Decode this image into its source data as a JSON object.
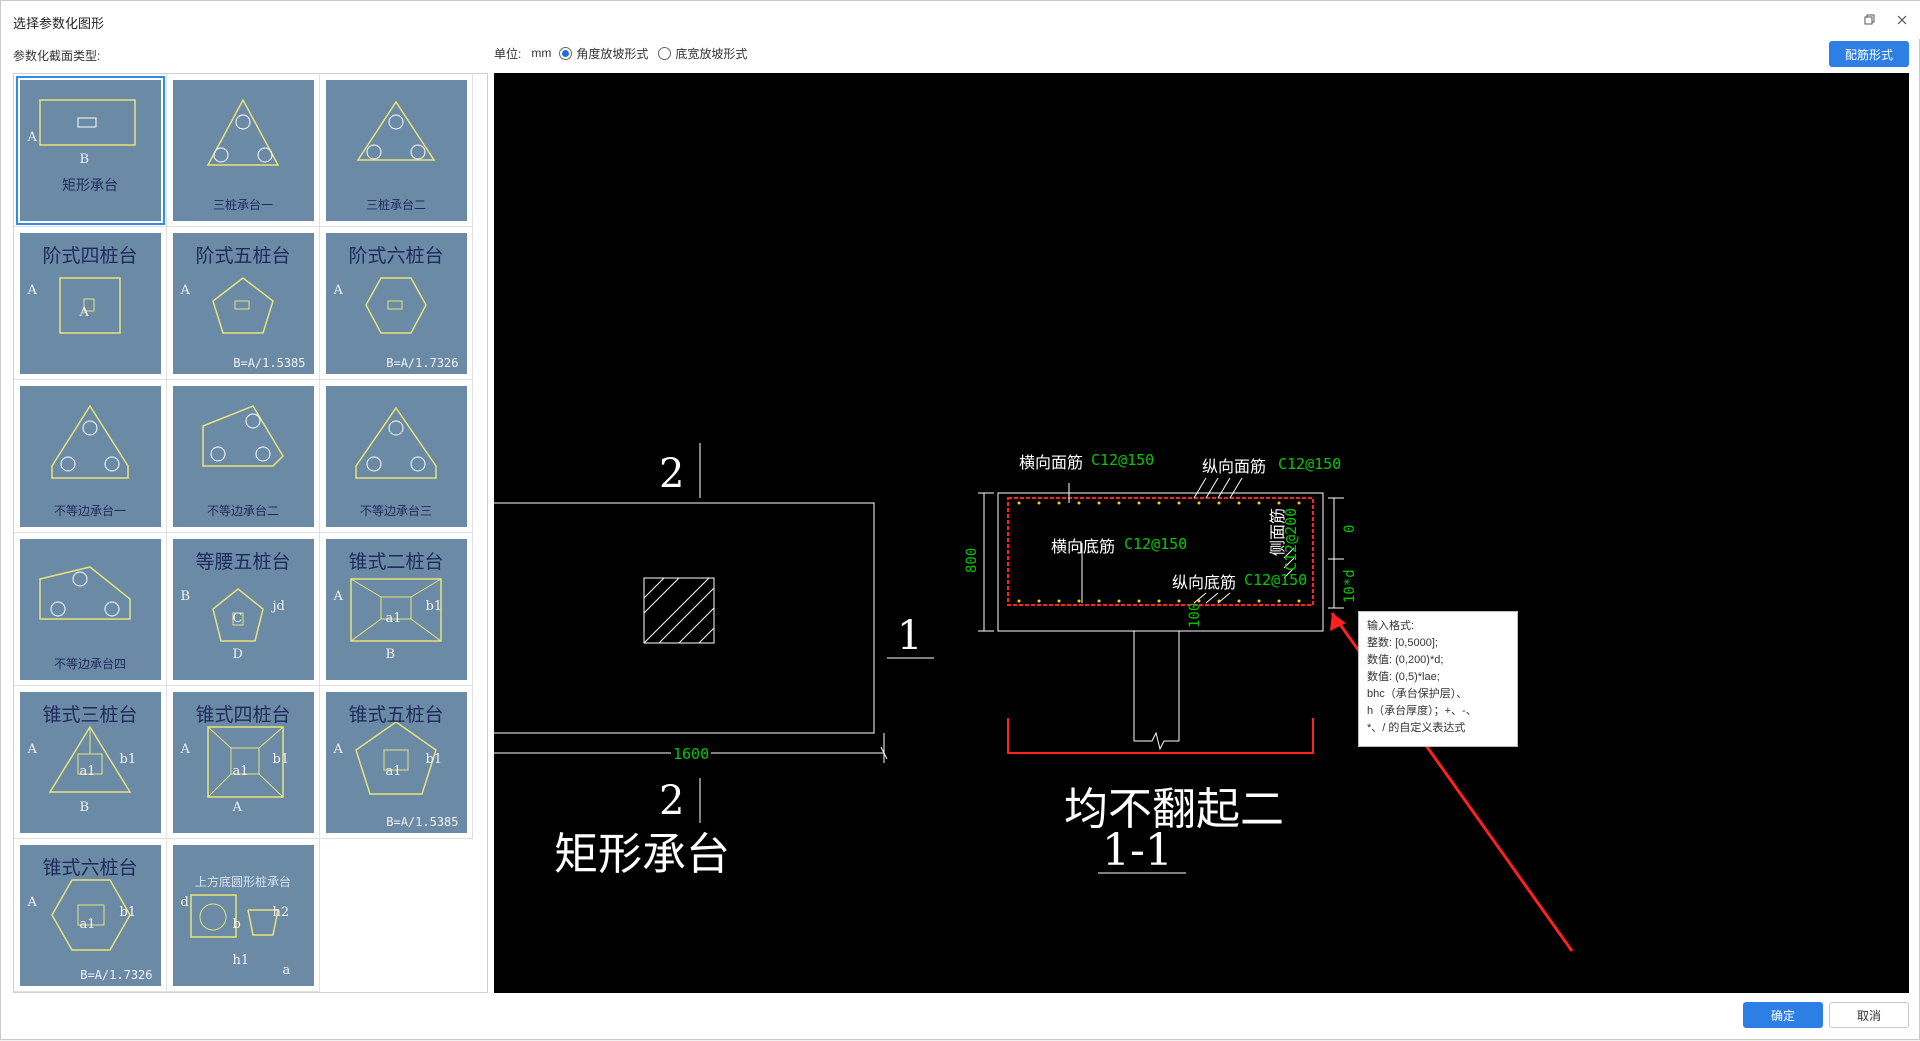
{
  "window": {
    "title": "选择参数化图形"
  },
  "header": {
    "section_label": "参数化截面类型:",
    "unit_label": "单位:",
    "unit_value": "mm",
    "options": [
      {
        "label": "角度放坡形式",
        "selected": true
      },
      {
        "label": "底宽放坡形式",
        "selected": false
      }
    ],
    "config_button": "配筋形式"
  },
  "shapes": [
    {
      "title": "",
      "bottom": "矩形承台",
      "note": "",
      "letters": [
        "A",
        "B"
      ],
      "selected": true
    },
    {
      "title": "",
      "bottom": "三桩承台一",
      "note": "",
      "letters": [],
      "selected": false
    },
    {
      "title": "",
      "bottom": "三桩承台二",
      "note": "",
      "letters": [],
      "selected": false
    },
    {
      "title": "阶式四桩台",
      "bottom": "",
      "note": "",
      "letters": [
        "A",
        "A"
      ],
      "selected": false
    },
    {
      "title": "阶式五桩台",
      "bottom": "",
      "note": "B=A/1.5385",
      "letters": [
        "A"
      ],
      "selected": false
    },
    {
      "title": "阶式六桩台",
      "bottom": "",
      "note": "B=A/1.7326",
      "letters": [
        "A"
      ],
      "selected": false
    },
    {
      "title": "",
      "bottom": "不等边承台一",
      "note": "",
      "letters": [],
      "selected": false
    },
    {
      "title": "",
      "bottom": "不等边承台二",
      "note": "",
      "letters": [],
      "selected": false
    },
    {
      "title": "",
      "bottom": "不等边承台三",
      "note": "",
      "letters": [],
      "selected": false
    },
    {
      "title": "",
      "bottom": "不等边承台四",
      "note": "",
      "letters": [],
      "selected": false
    },
    {
      "title": "等腰五桩台",
      "bottom": "",
      "note": "",
      "letters": [
        "B",
        "C",
        "jd",
        "D"
      ],
      "selected": false
    },
    {
      "title": "锥式二桩台",
      "bottom": "",
      "note": "",
      "letters": [
        "A",
        "a1",
        "b1",
        "B"
      ],
      "selected": false
    },
    {
      "title": "锥式三桩台",
      "bottom": "",
      "note": "",
      "letters": [
        "A",
        "a1",
        "b1",
        "B"
      ],
      "selected": false
    },
    {
      "title": "锥式四桩台",
      "bottom": "",
      "note": "",
      "letters": [
        "A",
        "a1",
        "b1",
        "A"
      ],
      "selected": false
    },
    {
      "title": "锥式五桩台",
      "bottom": "",
      "note": "B=A/1.5385",
      "letters": [
        "A",
        "a1",
        "b1"
      ],
      "selected": false
    },
    {
      "title": "锥式六桩台",
      "bottom": "",
      "note": "B=A/1.7326",
      "letters": [
        "A",
        "a1",
        "b1"
      ],
      "selected": false
    },
    {
      "title": "上方底圆形桩承台",
      "bottom": "",
      "note": "",
      "letters": [
        "d",
        "b",
        "h2",
        "h1",
        "a"
      ],
      "selected": false
    }
  ],
  "drawing": {
    "plan_title": "矩形承台",
    "section_mark_top": "2",
    "section_mark_bottom": "2",
    "section_mark_right": "1",
    "dim_width": "1600",
    "section_title": "均不翻起二",
    "section_name": "1-1",
    "label_top_transverse": "横向面筋",
    "value_top_transverse": "C12@150",
    "label_top_longitudinal": "纵向面筋",
    "value_top_longitudinal": "C12@150",
    "label_bottom_transverse": "横向底筋",
    "value_bottom_transverse": "C12@150",
    "label_bottom_longitudinal": "纵向底筋",
    "value_bottom_longitudinal": "C12@150",
    "label_side": "侧面筋",
    "value_side": "C12@200",
    "dim_height": "800",
    "dim_zero": "0",
    "dim_anchor": "10*d",
    "dim_cover": "100"
  },
  "tooltip": {
    "lines": [
      "输入格式:",
      "整数: [0,5000];",
      "数值: (0,200)*d;",
      "数值: (0,5)*lae;",
      "bhc（承台保护层）、",
      "h（承台厚度）；+、-、",
      "*、/ 的自定义表达式"
    ]
  },
  "footer": {
    "ok": "确定",
    "cancel": "取消"
  },
  "colors": {
    "accent": "#2d7fe6",
    "thumb_bg": "#6b8aa6",
    "rebar": "#ff2020",
    "dim_green": "#00c800"
  }
}
